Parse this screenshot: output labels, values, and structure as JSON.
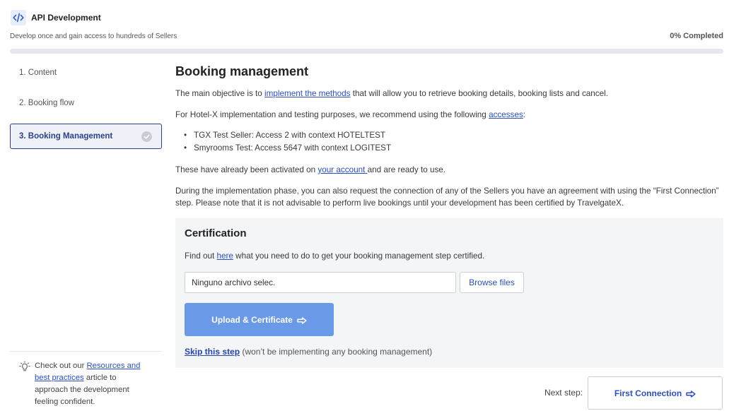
{
  "header": {
    "icon": "code-icon",
    "title": "API Development",
    "subtitle": "Develop once and gain access to hundreds of Sellers",
    "progress_label": "0% Completed",
    "progress_percent": 0
  },
  "sidebar": {
    "items": [
      {
        "label": "1. Content",
        "active": false
      },
      {
        "label": "2. Booking flow",
        "active": false
      },
      {
        "label": "3. Booking Management",
        "active": true,
        "status_icon": "check-circle-icon"
      }
    ],
    "tip": {
      "icon": "lightbulb-icon",
      "text_before": "Check out our ",
      "link": "Resources and best practices",
      "text_after": " article to approach the development feeling confident."
    }
  },
  "main": {
    "title": "Booking management",
    "intro": {
      "before": "The main objective is to ",
      "link": "implement the methods",
      "after": " that will allow you to retrieve booking details, booking lists and cancel."
    },
    "testing": {
      "before": "For Hotel-X implementation and testing purposes, we recommend using the following ",
      "link": "accesses",
      "after": ":"
    },
    "accesses": [
      "TGX Test Seller: Access 2 with context HOTELTEST",
      "Smyrooms Test: Access 5647 with context LOGITEST"
    ],
    "activated": {
      "before": "These have already been activated on ",
      "link": "your account ",
      "after": "and are ready to use."
    },
    "implementation_note": "During the implementation phase, you can also request the connection of any of the Sellers you have an agreement with using the “First Connection” step. Please note that it is not advisable to perform live bookings until your development has been certified by TravelgateX.",
    "certification": {
      "title": "Certification",
      "find_before": "Find out ",
      "find_link": "here",
      "find_after": " what you need to do to get your booking management step certified.",
      "file_value": "Ninguno archivo selec.",
      "browse_label": "Browse files",
      "upload_label": "Upload & Certificate",
      "upload_icon": "arrow-right-icon",
      "skip_link": "Skip this step",
      "skip_note": " (won’t be implementing any booking management)"
    },
    "next_step": {
      "label": "Next step:",
      "button_label": "First Connection",
      "button_icon": "arrow-right-icon"
    }
  },
  "colors": {
    "link": "#2a4fc7",
    "icon_accent": "#2b56c8",
    "active_item": "#2b3f8f",
    "primary_button": "#6a99e8",
    "panel_background": "#f4f5f7",
    "skip_link": "#2546a8"
  }
}
